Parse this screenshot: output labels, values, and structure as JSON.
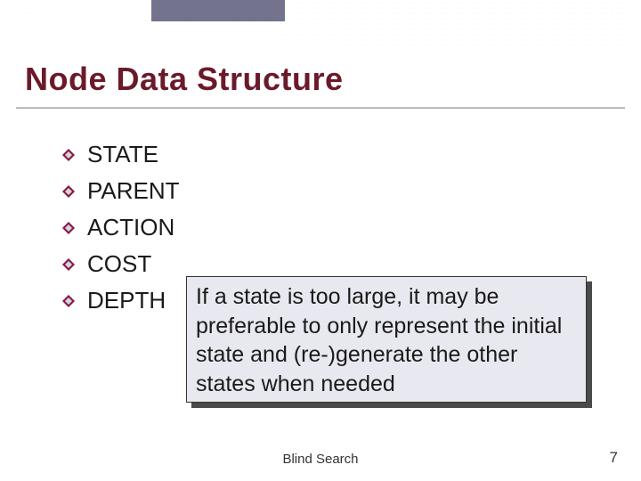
{
  "title": "Node Data Structure",
  "list": {
    "items": [
      {
        "label": "STATE"
      },
      {
        "label": "PARENT"
      },
      {
        "label": "ACTION"
      },
      {
        "label": "COST"
      },
      {
        "label": "DEPTH"
      }
    ]
  },
  "note": "If a state is too large, it may be preferable to only represent the initial state and (re-)generate the other states when needed",
  "footer": {
    "center": "Blind Search",
    "page": "7"
  }
}
